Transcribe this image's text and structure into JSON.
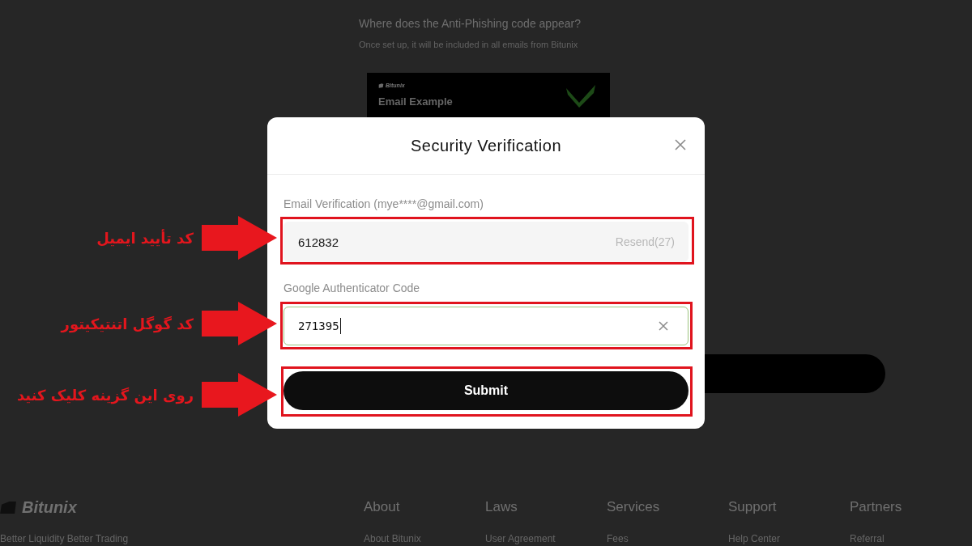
{
  "background_page": {
    "heading": "Where does the Anti-Phishing code appear?",
    "subtitle": "Once set up, it will be included in all emails from Bitunix",
    "email_example": {
      "brand": "Bitunix",
      "title": "Email Example"
    }
  },
  "dialog": {
    "title": "Security Verification",
    "fields": [
      {
        "kind": "resend",
        "label": "Email Verification (mye****@gmail.com)",
        "value": "612832",
        "action": "Resend(27)",
        "focused": false
      },
      {
        "kind": "clearable",
        "label": "Google Authenticator Code",
        "value": "271395",
        "focused": true
      }
    ],
    "submit": "Submit"
  },
  "annotations": [
    {
      "text": "کد تأیید ایمیل"
    },
    {
      "text": "کد گوگل اتنتیکیتور"
    },
    {
      "text": "روی این گزینه کلیک کنید"
    }
  ],
  "footer": {
    "brand": "Bitunix",
    "tagline": "Better Liquidity Better Trading",
    "columns": [
      {
        "heading": "About",
        "link": "About Bitunix"
      },
      {
        "heading": "Laws",
        "link": "User Agreement"
      },
      {
        "heading": "Services",
        "link": "Fees"
      },
      {
        "heading": "Support",
        "link": "Help Center"
      },
      {
        "heading": "Partners",
        "link": "Referral"
      }
    ]
  }
}
